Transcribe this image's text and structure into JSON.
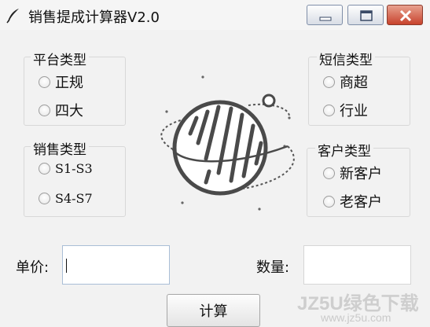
{
  "window": {
    "title": "销售提成计算器V2.0",
    "controls": [
      "minimize",
      "maximize",
      "close"
    ]
  },
  "groups": {
    "platform": {
      "legend": "平台类型",
      "options": [
        "正规",
        "四大"
      ]
    },
    "sales": {
      "legend": "销售类型",
      "options": [
        "S1-S3",
        "S4-S7"
      ]
    },
    "sms": {
      "legend": "短信类型",
      "options": [
        "商超",
        "行业"
      ]
    },
    "customer": {
      "legend": "客户类型",
      "options": [
        "新客户",
        "老客户"
      ]
    }
  },
  "fields": {
    "unit_price_label": "单价:",
    "unit_price_value": "",
    "quantity_label": "数量:",
    "quantity_value": ""
  },
  "buttons": {
    "calculate": "计算"
  },
  "watermark": {
    "main": "JZ5U绿色下载",
    "sub": "www.jz5u.com"
  },
  "illustration": {
    "icon": "planet-icon"
  },
  "colors": {
    "close_button": "#c8432d",
    "textbox_border": "#a9bed6",
    "background": "#f2f2f2"
  }
}
